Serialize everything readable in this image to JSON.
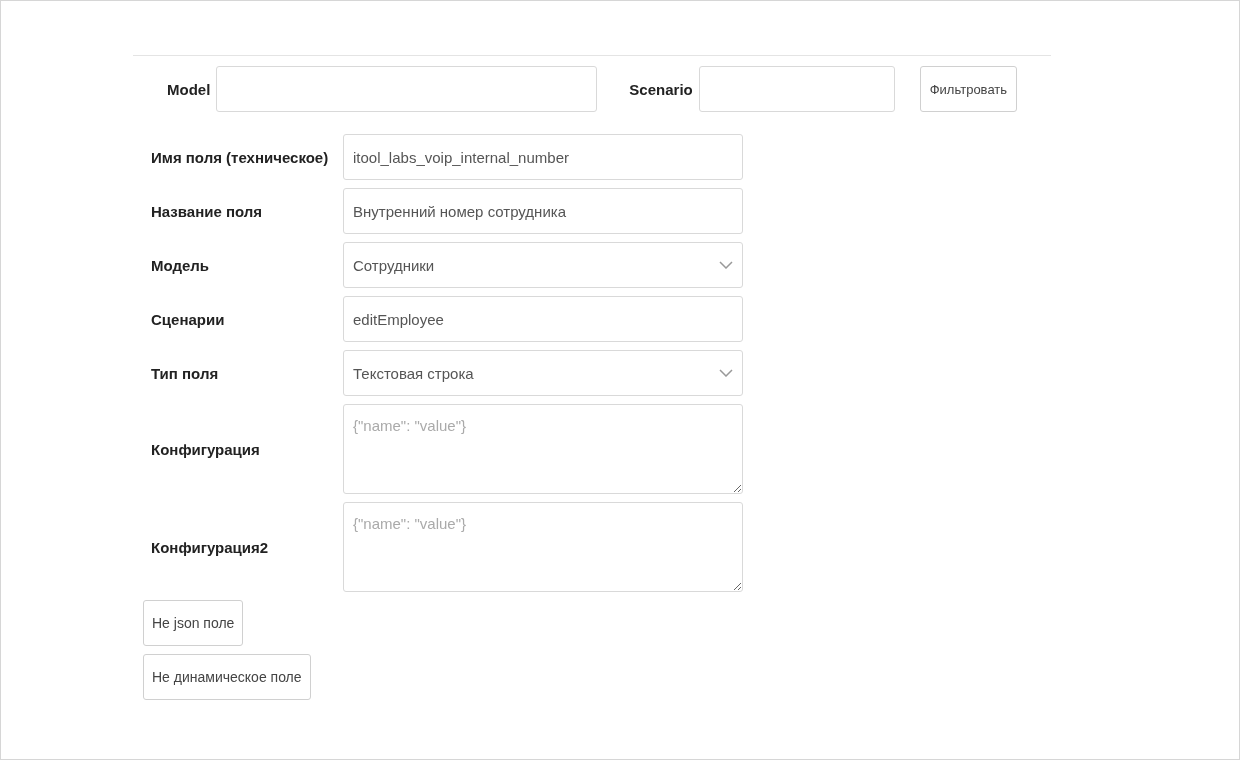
{
  "filter": {
    "model_label": "Model",
    "scenario_label": "Scenario",
    "button": "Фильтровать"
  },
  "form": {
    "fields": [
      {
        "kind": "text",
        "label": "Имя поля (техническое)",
        "value": "itool_labs_voip_internal_number"
      },
      {
        "kind": "text",
        "label": "Название поля",
        "value": "Внутренний номер сотрудника"
      },
      {
        "kind": "select",
        "label": "Модель",
        "value": "Сотрудники"
      },
      {
        "kind": "text",
        "label": "Сценарии",
        "value": "editEmployee"
      },
      {
        "kind": "select",
        "label": "Тип поля",
        "value": "Текстовая строка"
      },
      {
        "kind": "textarea",
        "label": "Конфигурация",
        "placeholder": "{\"name\": \"value\"}"
      },
      {
        "kind": "textarea",
        "label": "Конфигурация2",
        "placeholder": "{\"name\": \"value\"}"
      }
    ]
  },
  "buttons": [
    "Не json поле",
    "Не динамическое поле"
  ]
}
